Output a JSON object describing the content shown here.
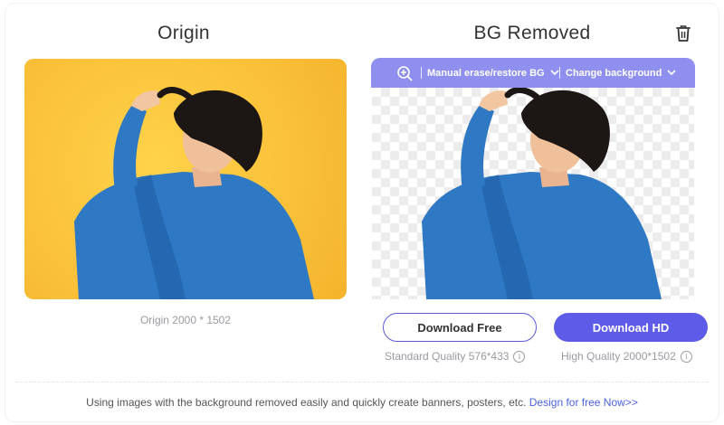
{
  "origin_panel": {
    "title": "Origin",
    "size_caption": "Origin 2000 * 1502"
  },
  "result_panel": {
    "title": "BG Removed",
    "toolbar": {
      "manual_label": "Manual erase/restore BG",
      "change_label": "Change background"
    }
  },
  "downloads": {
    "free_label": "Download Free",
    "hd_label": "Download HD",
    "standard_quality": "Standard Quality 576*433",
    "high_quality": "High Quality 2000*1502"
  },
  "footer": {
    "text": "Using images with the background removed easily and quickly create banners, posters, etc. ",
    "link_text": "Design for free Now>>"
  },
  "colors": {
    "accent": "#5d5be8",
    "toolbar": "#8f8ff0",
    "origin_bg": "#fac23a",
    "jacket": "#2f78c4",
    "link": "#4a62e0"
  },
  "icons": [
    "trash-icon",
    "zoom-in-icon",
    "chevron-down-icon",
    "info-icon"
  ]
}
